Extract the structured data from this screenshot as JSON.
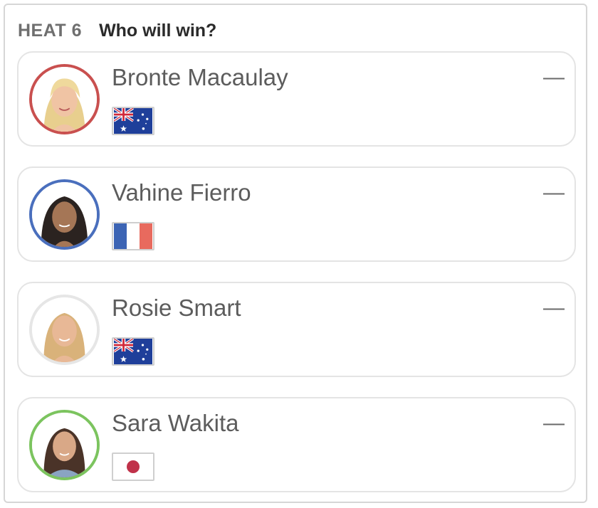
{
  "header": {
    "heat": "HEAT 6",
    "question": "Who will win?"
  },
  "colors": {
    "ring_red": "#c9504f",
    "ring_blue": "#4a6fbd",
    "ring_none": "#e6e6e6",
    "ring_green": "#7cc45f",
    "text": "#5c5c5c",
    "heading": "#2a2a2a",
    "subheading": "#6f6f6f"
  },
  "surfers": [
    {
      "name": "Bronte Macaulay",
      "country_flag": "australia-flag-icon",
      "ring": "ring_red",
      "pick": "—"
    },
    {
      "name": "Vahine Fierro",
      "country_flag": "france-flag-icon",
      "ring": "ring_blue",
      "pick": "—"
    },
    {
      "name": "Rosie Smart",
      "country_flag": "australia-flag-icon",
      "ring": "ring_none",
      "pick": "—"
    },
    {
      "name": "Sara Wakita",
      "country_flag": "japan-flag-icon",
      "ring": "ring_green",
      "pick": "—"
    }
  ]
}
